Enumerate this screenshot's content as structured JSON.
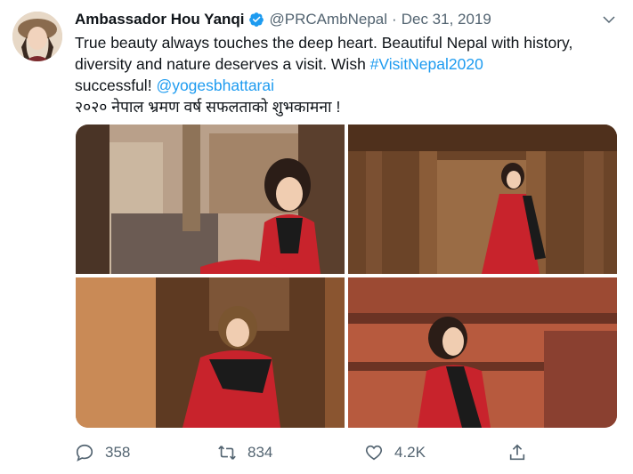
{
  "tweet": {
    "author_name": "Ambassador Hou Yanqi",
    "handle": "@PRCAmbNepal",
    "separator": "·",
    "date": "Dec 31, 2019",
    "text_part1": "True beauty always touches the deep heart.  Beautiful Nepal with history, diversity and nature deserves a visit.  Wish ",
    "hashtag": "#VisitNepal2020",
    "text_part2": " successful! ",
    "mention": "@yogesbhattarai",
    "text_line_nepali": "२०२० नेपाल भ्रमण वर्ष सफलताको शुभकामना !"
  },
  "actions": {
    "reply_count": "358",
    "retweet_count": "834",
    "like_count": "4.2K"
  },
  "icons": {
    "verified": "verified-badge-icon",
    "caret": "chevron-down-icon",
    "reply": "reply-icon",
    "retweet": "retweet-icon",
    "like": "heart-icon",
    "share": "share-icon"
  },
  "colors": {
    "link": "#1d9bf0",
    "muted": "#536471",
    "dress_red": "#c8232c"
  }
}
